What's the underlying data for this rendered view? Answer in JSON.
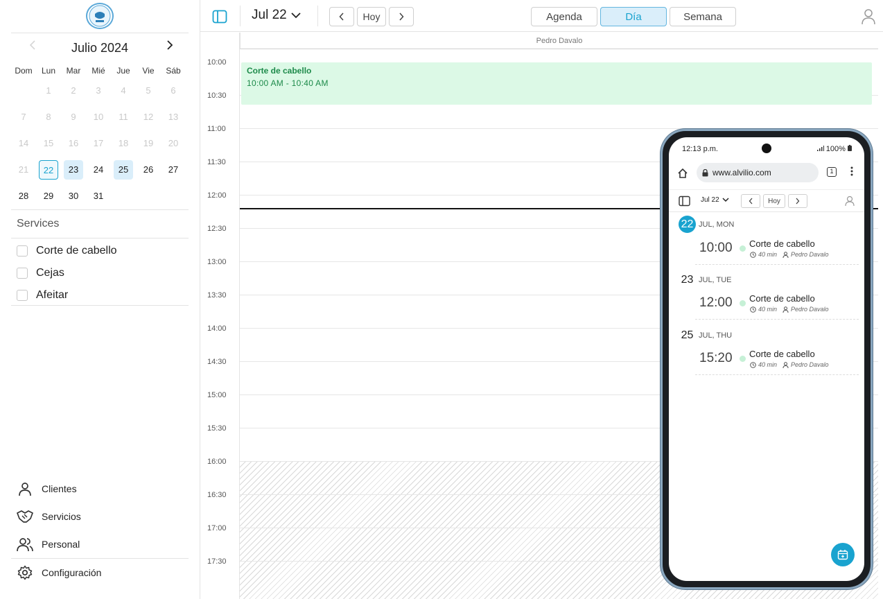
{
  "app": {
    "logo_text": "BARBERIA CLASICA"
  },
  "mini_calendar": {
    "title": "Julio 2024",
    "dow": [
      "Dom",
      "Lun",
      "Mar",
      "Mié",
      "Jue",
      "Vie",
      "Sáb"
    ],
    "weeks": [
      [
        "",
        "1",
        "2",
        "3",
        "4",
        "5",
        "6"
      ],
      [
        "7",
        "8",
        "9",
        "10",
        "11",
        "12",
        "13"
      ],
      [
        "14",
        "15",
        "16",
        "17",
        "18",
        "19",
        "20"
      ],
      [
        "21",
        "22",
        "23",
        "24",
        "25",
        "26",
        "27"
      ],
      [
        "28",
        "29",
        "30",
        "31",
        "",
        "",
        ""
      ]
    ]
  },
  "services": {
    "title": "Services",
    "items": [
      {
        "label": "Corte de cabello"
      },
      {
        "label": "Cejas"
      },
      {
        "label": "Afeitar"
      }
    ]
  },
  "nav": {
    "items": [
      {
        "label": "Clientes",
        "icon": "user-icon"
      },
      {
        "label": "Servicios",
        "icon": "handshake-icon"
      },
      {
        "label": "Personal",
        "icon": "users-icon"
      },
      {
        "label": "Configuración",
        "icon": "gear-icon"
      }
    ]
  },
  "toolbar": {
    "date": "Jul 22",
    "today": "Hoy",
    "views": [
      "Agenda",
      "Día",
      "Semana"
    ],
    "active_view": "Día"
  },
  "day": {
    "staff": "Pedro Davalo",
    "times": [
      "10:00",
      "10:30",
      "11:00",
      "11:30",
      "12:00",
      "12:30",
      "13:00",
      "13:30",
      "14:00",
      "14:30",
      "15:00",
      "15:30",
      "16:00",
      "16:30",
      "17:00",
      "17:30"
    ],
    "event": {
      "title": "Corte de cabello",
      "time": "10:00 AM  -  10:40 AM"
    }
  },
  "phone": {
    "status_time": "12:13 p.m.",
    "battery": "100%",
    "url": "www.alvilio.com",
    "tabs_count": "1",
    "toolbar_date": "Jul 22",
    "today": "Hoy",
    "days": [
      {
        "num": "22",
        "label": "JUL, MON",
        "appt": {
          "time": "10:00",
          "name": "Corte de cabello",
          "duration": "40 min",
          "staff": "Pedro Davalo"
        }
      },
      {
        "num": "23",
        "label": "JUL, TUE",
        "appt": {
          "time": "12:00",
          "name": "Corte de cabello",
          "duration": "40 min",
          "staff": "Pedro Davalo"
        }
      },
      {
        "num": "25",
        "label": "JUL, THU",
        "appt": {
          "time": "15:20",
          "name": "Corte de cabello",
          "duration": "40 min",
          "staff": "Pedro Davalo"
        }
      }
    ]
  },
  "colors": {
    "accent": "#19a3cf",
    "event_bg": "#dcf9e6",
    "event_text": "#1d8a4a"
  }
}
